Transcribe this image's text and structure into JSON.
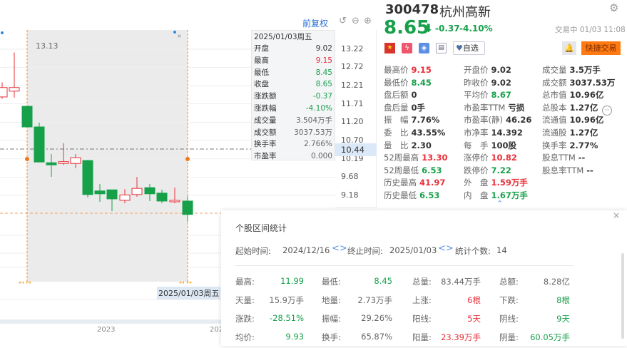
{
  "toolbar": {
    "adjust_label": "前复权"
  },
  "chart": {
    "max_label": "13.13",
    "date_label": "2025/01/03周五",
    "nav_year1": "2023",
    "nav_year2": "202",
    "current_axis": "10.44",
    "y_ticks": [
      "13.22",
      "12.72",
      "12.21",
      "11.71",
      "11.20",
      "10.70",
      "10.19",
      "9.68",
      "9.18"
    ],
    "candles": [
      {
        "o": 11.9,
        "h": 12.3,
        "l": 11.85,
        "c": 12.16
      },
      {
        "o": 12.06,
        "h": 13.13,
        "l": 11.88,
        "c": 12.16
      },
      {
        "o": 11.64,
        "h": 11.64,
        "l": 11.07,
        "c": 11.07
      },
      {
        "o": 11.07,
        "h": 11.19,
        "l": 10.1,
        "c": 10.1
      },
      {
        "o": 10.08,
        "h": 10.32,
        "l": 9.69,
        "c": 10.02
      },
      {
        "o": 10.06,
        "h": 10.62,
        "l": 10.02,
        "c": 10.11
      },
      {
        "o": 10.06,
        "h": 10.32,
        "l": 9.93,
        "c": 10.22
      },
      {
        "o": 10.14,
        "h": 10.16,
        "l": 9.12,
        "c": 9.2
      },
      {
        "o": 9.3,
        "h": 9.49,
        "l": 9.0,
        "c": 9.22
      },
      {
        "o": 9.33,
        "h": 9.33,
        "l": 8.74,
        "c": 9.08
      },
      {
        "o": 9.04,
        "h": 9.35,
        "l": 8.96,
        "c": 9.19
      },
      {
        "o": 9.2,
        "h": 9.69,
        "l": 9.14,
        "c": 9.37
      },
      {
        "o": 9.39,
        "h": 9.49,
        "l": 9.02,
        "c": 9.22
      },
      {
        "o": 9.24,
        "h": 9.33,
        "l": 8.96,
        "c": 9.02
      },
      {
        "o": 9.0,
        "h": 9.39,
        "l": 8.96,
        "c": 9.04
      },
      {
        "o": 9.02,
        "h": 9.15,
        "l": 8.45,
        "c": 8.65
      }
    ]
  },
  "tooltip": {
    "date": "2025/01/03周五",
    "rows": [
      {
        "label": "开盘",
        "value": "9.02",
        "color": "#333"
      },
      {
        "label": "最高",
        "value": "9.15",
        "color": "#e8313a"
      },
      {
        "label": "最低",
        "value": "8.45",
        "color": "#17a04a"
      },
      {
        "label": "收盘",
        "value": "8.65",
        "color": "#17a04a"
      },
      {
        "label": "涨跌额",
        "value": "-0.37",
        "color": "#17a04a"
      },
      {
        "label": "涨跌幅",
        "value": "-4.10%",
        "color": "#17a04a"
      },
      {
        "label": "成交量",
        "value": "3.504万手",
        "color": "#666"
      },
      {
        "label": "成交额",
        "value": "3037.53万",
        "color": "#666"
      },
      {
        "label": "换手率",
        "value": "2.766%",
        "color": "#666"
      },
      {
        "label": "市盈率",
        "value": "0.000",
        "color": "#666"
      }
    ]
  },
  "stock": {
    "code": "300478",
    "name": "杭州高新",
    "price": "8.65",
    "change": "-0.37",
    "pct": "-4.10%",
    "status": "交易中 01/03 11:08",
    "watch_label": "自选",
    "trade_label": "快捷交易"
  },
  "stats": [
    [
      {
        "l": "最高价",
        "v": "9.15",
        "c": "#e8313a"
      },
      {
        "l": "最低价",
        "v": "8.45",
        "c": "#17a04a"
      },
      {
        "l": "盘后额",
        "v": "0"
      },
      {
        "l": "盘后量",
        "v": "0手"
      },
      {
        "l": "振　幅",
        "v": "7.76%"
      },
      {
        "l": "委　比",
        "v": "43.55%"
      },
      {
        "l": "量　比",
        "v": "2.30"
      },
      {
        "l": "52周最高",
        "v": "13.30",
        "c": "#e8313a"
      },
      {
        "l": "52周最低",
        "v": "6.53",
        "c": "#17a04a"
      },
      {
        "l": "历史最高",
        "v": "41.97",
        "c": "#e8313a"
      },
      {
        "l": "历史最低",
        "v": "6.53",
        "c": "#17a04a"
      }
    ],
    [
      {
        "l": "开盘价",
        "v": "9.02"
      },
      {
        "l": "昨收价",
        "v": "9.02"
      },
      {
        "l": "平均价",
        "v": "8.67",
        "c": "#17a04a"
      },
      {
        "l": "市盈率TTM",
        "v": "亏损"
      },
      {
        "l": "市盈率(静)",
        "v": "46.26"
      },
      {
        "l": "市净率",
        "v": "14.392"
      },
      {
        "l": "每　手",
        "v": "100股"
      },
      {
        "l": "涨停价",
        "v": "10.82",
        "c": "#e8313a"
      },
      {
        "l": "跌停价",
        "v": "7.22",
        "c": "#17a04a"
      },
      {
        "l": "外　盘",
        "v": "1.59万手",
        "c": "#e8313a"
      },
      {
        "l": "内　盘",
        "v": "1.67万手",
        "c": "#17a04a"
      }
    ],
    [
      {
        "l": "成交量",
        "v": "3.5万手"
      },
      {
        "l": "成交额",
        "v": "3037.53万"
      },
      {
        "l": "总市值",
        "v": "10.96亿"
      },
      {
        "l": "总股本",
        "v": "1.27亿"
      },
      {
        "l": "流通值",
        "v": "10.96亿"
      },
      {
        "l": "流通股",
        "v": "1.27亿"
      },
      {
        "l": "换手率",
        "v": "2.77%"
      },
      {
        "l": "股息TTM",
        "v": "--"
      },
      {
        "l": "股息率TTM",
        "v": "--"
      }
    ]
  ],
  "popup": {
    "title": "个股区间统计",
    "start_label": "起始时间:",
    "start": "2024/12/16",
    "end_label": "终止时间:",
    "end": "2025/01/03",
    "count_label": "统计个数:",
    "count": "14",
    "close": "×",
    "rows": [
      [
        {
          "l": "最高:",
          "v": "11.99",
          "c": "#17a04a"
        },
        {
          "l": "最低:",
          "v": "8.45",
          "c": "#17a04a"
        },
        {
          "l": "总量:",
          "v": "83.44万手",
          "c": "#666"
        },
        {
          "l": "总额:",
          "v": "8.28亿",
          "c": "#666"
        }
      ],
      [
        {
          "l": "天量:",
          "v": "15.9万手",
          "c": "#666"
        },
        {
          "l": "地量:",
          "v": "2.73万手",
          "c": "#666"
        },
        {
          "l": "上涨:",
          "v": "6根",
          "c": "#e8313a"
        },
        {
          "l": "下跌:",
          "v": "8根",
          "c": "#17a04a"
        }
      ],
      [
        {
          "l": "涨跌:",
          "v": "-28.51%",
          "c": "#17a04a"
        },
        {
          "l": "振幅:",
          "v": "29.26%",
          "c": "#666"
        },
        {
          "l": "阳线:",
          "v": "5天",
          "c": "#e8313a"
        },
        {
          "l": "阴线:",
          "v": "9天",
          "c": "#17a04a"
        }
      ],
      [
        {
          "l": "均价:",
          "v": "9.93",
          "c": "#17a04a"
        },
        {
          "l": "换手:",
          "v": "65.87%",
          "c": "#666"
        },
        {
          "l": "阳量:",
          "v": "23.39万手",
          "c": "#e8313a"
        },
        {
          "l": "阴量:",
          "v": "60.05万手",
          "c": "#17a04a"
        }
      ]
    ]
  }
}
